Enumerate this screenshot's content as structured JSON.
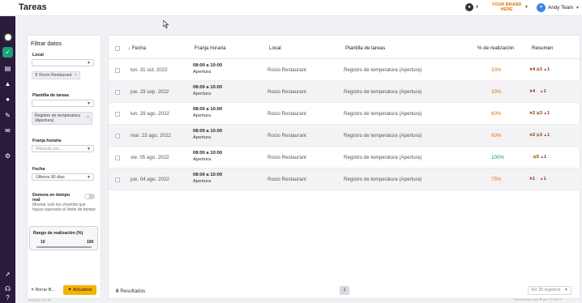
{
  "header": {
    "title": "Tareas",
    "brand_line1": "YOUR BRAND",
    "brand_line2": "HERE",
    "user_name": "Andy Team"
  },
  "filters": {
    "title": "Filtrar datos",
    "local_label": "Local",
    "local_chip": "Rocio Restaurant",
    "plantilla_label": "Plantilla de tareas",
    "plantilla_chip_line1": "Registro de temperatura",
    "plantilla_chip_line2": "(Apertura)",
    "franja_label": "Franja horaria",
    "franja_placeholder": "Filtrando por...",
    "fecha_label": "Fecha",
    "fecha_value": "Últimos 90 días",
    "demora_label_line1": "Demora en tiempo",
    "demora_label_line2": "real",
    "demora_help": "Mostrar solo los checklist que hayan superado el límite de tiempo",
    "range_label": "Rango de realización (%)",
    "range_min": "10",
    "range_max": "100",
    "clear_label": "Borrar fil...",
    "update_label": "Actualizar"
  },
  "table": {
    "columns": [
      "Fecha",
      "Franja horaria",
      "Local",
      "Plantilla de tareas",
      "% de realización",
      "Resumen"
    ],
    "rows": [
      {
        "fecha": "lun. 31 oct. 2022",
        "franja_time": "08:00 a 10:00",
        "franja_name": "Apertura",
        "local": "Rocio Restaurant",
        "plantilla": "Registro de temperatura (Apertura)",
        "pct": "33%",
        "pct_color": "#d97706",
        "sum_red": "4",
        "sum_orange": "1",
        "sum_warn": "1",
        "sum_gray": "0"
      },
      {
        "fecha": "jue. 29 sep. 2022",
        "franja_time": "08:00 a 10:00",
        "franja_name": "Apertura",
        "local": "Rocio Restaurant",
        "plantilla": "Registro de temperatura (Apertura)",
        "pct": "33%",
        "pct_color": "#d97706",
        "sum_red": "4",
        "sum_orange": "",
        "sum_warn": "1",
        "sum_gray": "0"
      },
      {
        "fecha": "lun. 29 ago. 2022",
        "franja_time": "08:00 a 10:00",
        "franja_name": "Apertura",
        "local": "Rocio Restaurant",
        "plantilla": "Registro de temperatura (Apertura)",
        "pct": "60%",
        "pct_color": "#d97706",
        "sum_red": "2",
        "sum_orange": "3",
        "sum_warn": "1",
        "sum_gray": "0"
      },
      {
        "fecha": "mar. 23 ago. 2022",
        "franja_time": "08:00 a 10:00",
        "franja_name": "Apertura",
        "local": "Rocio Restaurant",
        "plantilla": "Registro de temperatura (Apertura)",
        "pct": "60%",
        "pct_color": "#d97706",
        "sum_red": "2",
        "sum_orange": "3",
        "sum_warn": "1",
        "sum_gray": "0"
      },
      {
        "fecha": "vie. 05 ago. 2022",
        "franja_time": "08:00 a 10:00",
        "franja_name": "Apertura",
        "local": "Rocio Restaurant",
        "plantilla": "Registro de temperatura (Apertura)",
        "pct": "100%",
        "pct_color": "#16a34a",
        "sum_red": "",
        "sum_orange": "5",
        "sum_warn": "1",
        "sum_gray": "0"
      },
      {
        "fecha": "jue. 04 ago. 2022",
        "franja_time": "08:00 a 10:00",
        "franja_name": "Apertura",
        "local": "Rocio Restaurant",
        "plantilla": "Registro de temperatura (Apertura)",
        "pct": "75%",
        "pct_color": "#d97706",
        "sum_red": "1",
        "sum_orange": "",
        "sum_warn": "1",
        "sum_gray": "0"
      }
    ],
    "results_count": "6",
    "results_label": "Resultados",
    "page": "1",
    "per_page": "Ver 20 registros"
  },
  "footer": {
    "version": "Versión: 3.1.35",
    "credit": "Desarrollado con ❤ por YTDEV ©"
  }
}
